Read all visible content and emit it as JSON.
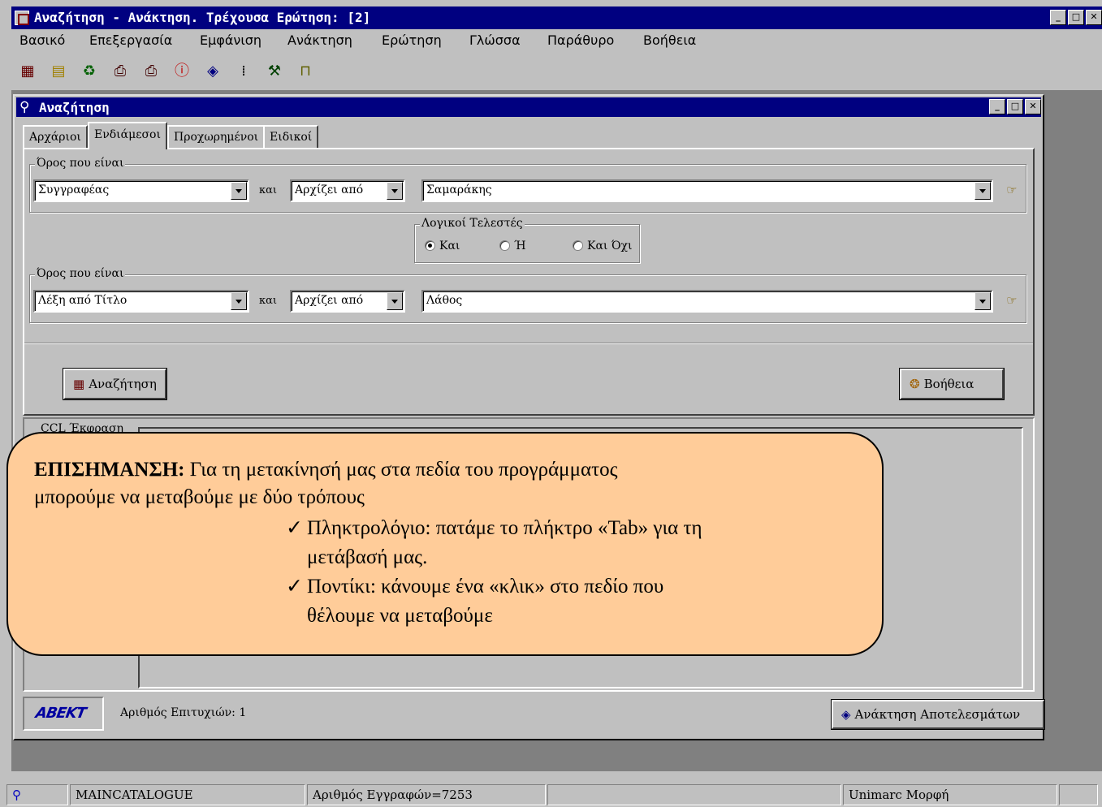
{
  "app": {
    "title": "Αναζήτηση - Ανάκτηση. Τρέχουσα Ερώτηση: [2]",
    "menu": [
      "Βασικό",
      "Επεξεργασία",
      "Εμφάνιση",
      "Ανάκτηση",
      "Ερώτηση",
      "Γλώσσα",
      "Παράθυρο",
      "Βοήθεια"
    ],
    "toolbar_icons": [
      "search-icon",
      "folders-icon",
      "recycle-icon",
      "print-icon",
      "print-icon",
      "info-icon",
      "eye-icon",
      "barcode-icon",
      "tools-icon",
      "door-icon"
    ]
  },
  "search": {
    "title": "Αναζήτηση",
    "tabs": [
      "Αρχάριοι",
      "Ενδιάμεσοι",
      "Προχωρημένοι",
      "Ειδικοί"
    ],
    "active_tab": "Ενδιάμεσοι",
    "term1": {
      "group_label": "Όρος που είναι",
      "field": "Συγγραφέας",
      "connector": "και",
      "mode": "Αρχίζει από",
      "value": "Σαμαράκης"
    },
    "logic": {
      "group_label": "Λογικοί Τελεστές",
      "options": [
        "Και",
        "Ή",
        "Και Όχι"
      ],
      "selected": "Και"
    },
    "term2": {
      "group_label": "Όρος που είναι",
      "field": "Λέξη από Τίτλο",
      "connector": "και",
      "mode": "Αρχίζει από",
      "value": "Λάθος"
    },
    "search_button": "Αναζήτηση",
    "help_button": "Βοήθεια",
    "ccl_label": "CCL Έκφραση",
    "logo_text": "ABEKT",
    "hits_label": "Αριθμός Επιτυχιών:",
    "hits_value": "1",
    "retrieve_button": "Ανάκτηση Αποτελεσμάτων"
  },
  "status": {
    "catalogue": "MAINCATALOGUE",
    "records": "Αριθμός Εγγραφών=7253",
    "format": "Unimarc Μορφή"
  },
  "callout": {
    "title_bold": "ΕΠΙΣΗΜΑΝΣΗ:",
    "title_rest": " Για τη μετακίνησή μας στα πεδία του προγράμματος",
    "line2": "μπορούμε να μεταβούμε με δύο τρόπους",
    "bullets": [
      [
        "Πληκτρολόγιο: πατάμε το πλήκτρο «Tab» για τη",
        "μετάβασή μας."
      ],
      [
        "Ποντίκι: κάνουμε ένα «κλικ» στο πεδίο που",
        "θέλουμε να μεταβούμε"
      ]
    ],
    "check": "✓"
  },
  "colors": {
    "titlebar": "#000080",
    "face": "#c0c0c0",
    "callout_fill": "#ffcc99"
  }
}
